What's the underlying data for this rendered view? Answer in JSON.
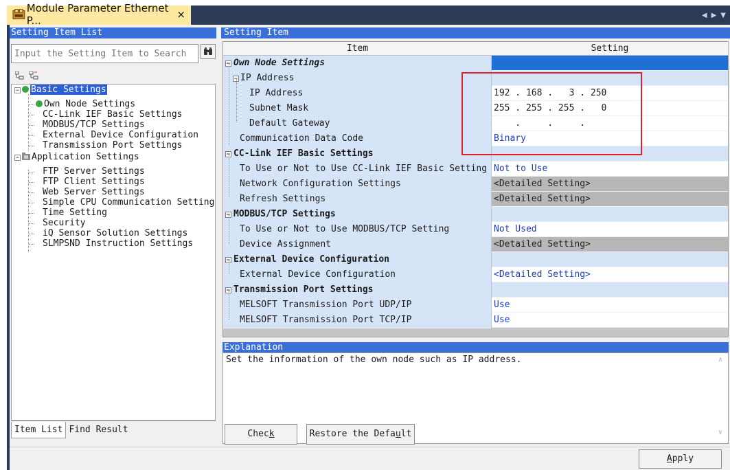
{
  "tab": {
    "title": "Module Parameter Ethernet P...",
    "close": "×"
  },
  "tabstrip_controls": {
    "left": "◀",
    "right": "▶",
    "menu": "▼"
  },
  "left": {
    "header": "Setting Item List",
    "search_placeholder": "Input the Setting Item to Search",
    "tree": [
      {
        "label": "Basic Settings"
      },
      {
        "label": "Own Node Settings"
      },
      {
        "label": "CC-Link IEF Basic Settings"
      },
      {
        "label": "MODBUS/TCP Settings"
      },
      {
        "label": "External Device Configuration"
      },
      {
        "label": "Transmission Port Settings"
      },
      {
        "label": "Application Settings"
      },
      {
        "label": "FTP Server Settings"
      },
      {
        "label": "FTP Client Settings"
      },
      {
        "label": "Web Server Settings"
      },
      {
        "label": "Simple CPU Communication Setting"
      },
      {
        "label": "Time Setting"
      },
      {
        "label": "Security"
      },
      {
        "label": "iQ Sensor Solution Settings"
      },
      {
        "label": "SLMPSND Instruction Settings"
      }
    ],
    "bottom_tabs": [
      "Item List",
      "Find Result"
    ]
  },
  "right": {
    "header": "Setting Item",
    "columns": {
      "item": "Item",
      "setting": "Setting"
    },
    "rows": [
      {
        "item": "Own Node Settings",
        "setting": ""
      },
      {
        "item": "IP Address",
        "setting": ""
      },
      {
        "item": "IP Address",
        "setting": "192 . 168 .   3 . 250"
      },
      {
        "item": "Subnet Mask",
        "setting": "255 . 255 . 255 .   0"
      },
      {
        "item": "Default Gateway",
        "setting": "    .     .     ."
      },
      {
        "item": "Communication Data Code",
        "setting": "Binary"
      },
      {
        "item": "CC-Link IEF Basic Settings",
        "setting": ""
      },
      {
        "item": "To Use or Not to Use CC-Link IEF Basic Setting",
        "setting": "Not to Use"
      },
      {
        "item": "Network Configuration Settings",
        "setting": "<Detailed Setting>"
      },
      {
        "item": "Refresh Settings",
        "setting": "<Detailed Setting>"
      },
      {
        "item": "MODBUS/TCP Settings",
        "setting": ""
      },
      {
        "item": "To Use or Not to Use MODBUS/TCP Setting",
        "setting": "Not Used"
      },
      {
        "item": "Device Assignment",
        "setting": "<Detailed Setting>"
      },
      {
        "item": "External Device Configuration",
        "setting": ""
      },
      {
        "item": "External Device Configuration",
        "setting": "<Detailed Setting>"
      },
      {
        "item": "Transmission Port Settings",
        "setting": ""
      },
      {
        "item": "MELSOFT Transmission Port UDP/IP",
        "setting": "Use"
      },
      {
        "item": "MELSOFT Transmission Port TCP/IP",
        "setting": "Use"
      }
    ],
    "explanation_header": "Explanation",
    "explanation_text": "Set the information of the own node such as IP address.",
    "check_prefix": "Chec",
    "check_accel": "k",
    "restore_prefix": "Restore the Defa",
    "restore_accel": "u",
    "restore_suffix": "lt",
    "apply_accel": "A",
    "apply_suffix": "pply"
  },
  "colors": {
    "header_blue": "#3a6fd8",
    "item_bg": "#d6e4f7",
    "highlight_red": "#e0232a",
    "link_blue": "#1f3fb3"
  }
}
